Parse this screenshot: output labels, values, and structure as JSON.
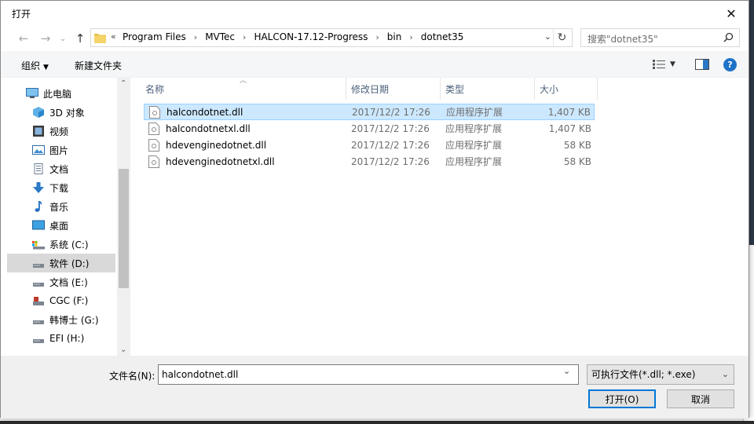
{
  "window": {
    "title": "打开"
  },
  "address": {
    "overflow": "«",
    "crumbs": [
      "Program Files",
      "MVTec",
      "HALCON-17.12-Progress",
      "bin",
      "dotnet35"
    ],
    "separator": "›"
  },
  "search": {
    "placeholder": "搜索\"dotnet35\""
  },
  "toolbar": {
    "organize": "组织",
    "new_folder": "新建文件夹",
    "help": "?"
  },
  "nav": {
    "items": [
      {
        "label": "此电脑",
        "icon": "computer-icon"
      },
      {
        "label": "3D 对象",
        "icon": "3d-objects-icon"
      },
      {
        "label": "视频",
        "icon": "video-icon"
      },
      {
        "label": "图片",
        "icon": "pictures-icon"
      },
      {
        "label": "文档",
        "icon": "documents-icon"
      },
      {
        "label": "下载",
        "icon": "download-icon"
      },
      {
        "label": "音乐",
        "icon": "music-icon"
      },
      {
        "label": "桌面",
        "icon": "desktop-icon"
      },
      {
        "label": "系统 (C:)",
        "icon": "drive-c-icon"
      },
      {
        "label": "软件 (D:)",
        "icon": "drive-icon"
      },
      {
        "label": "文档 (E:)",
        "icon": "drive-icon"
      },
      {
        "label": "CGC (F:)",
        "icon": "drive-icon"
      },
      {
        "label": "韩博士 (G:)",
        "icon": "drive-icon"
      },
      {
        "label": "EFI (H:)",
        "icon": "drive-icon"
      }
    ]
  },
  "columns": {
    "name": "名称",
    "date": "修改日期",
    "type": "类型",
    "size": "大小"
  },
  "files": [
    {
      "name": "halcondotnet.dll",
      "date": "2017/12/2 17:26",
      "type": "应用程序扩展",
      "size": "1,407 KB"
    },
    {
      "name": "halcondotnetxl.dll",
      "date": "2017/12/2 17:26",
      "type": "应用程序扩展",
      "size": "1,407 KB"
    },
    {
      "name": "hdevenginedotnet.dll",
      "date": "2017/12/2 17:26",
      "type": "应用程序扩展",
      "size": "58 KB"
    },
    {
      "name": "hdevenginedotnetxl.dll",
      "date": "2017/12/2 17:26",
      "type": "应用程序扩展",
      "size": "58 KB"
    }
  ],
  "bottom": {
    "filename_label": "文件名(N):",
    "filename_value": "halcondotnet.dll",
    "filter": "可执行文件(*.dll; *.exe)",
    "open": "打开(O)",
    "cancel": "取消"
  },
  "colors": {
    "accent": "#0078d7",
    "selection": "#cce8ff",
    "help": "#1e73c7"
  }
}
